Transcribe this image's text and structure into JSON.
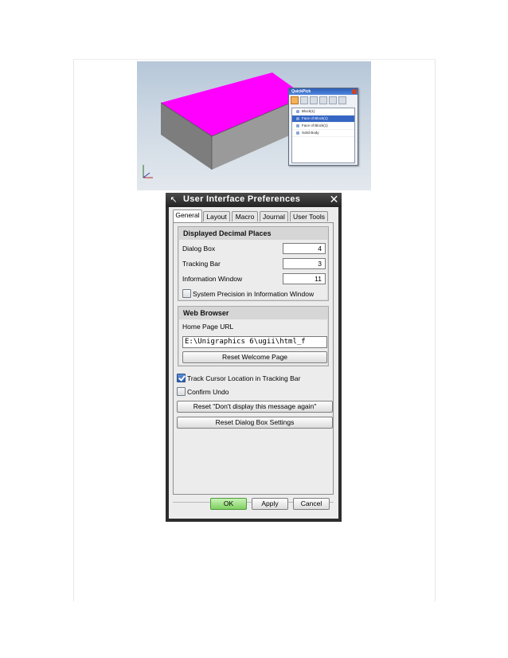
{
  "viewport": {
    "quickpick": {
      "title": "QuickPick",
      "items": [
        "Block(1)",
        "Face of Block(1)",
        "Face of Block(1)",
        "Solid Body"
      ],
      "selected_index": 1
    },
    "colors": {
      "top_face": "#ff00ff",
      "side_face": "#8c8c8c"
    }
  },
  "dialog": {
    "title": "User Interface Preferences",
    "tabs": [
      {
        "label": "General"
      },
      {
        "label": "Layout"
      },
      {
        "label": "Macro"
      },
      {
        "label": "Journal"
      },
      {
        "label": "User Tools"
      }
    ],
    "active_tab": "General",
    "decimal_group": {
      "title": "Displayed Decimal Places",
      "dialog_box": {
        "label": "Dialog Box",
        "value": "4"
      },
      "tracking_bar": {
        "label": "Tracking Bar",
        "value": "3"
      },
      "information_window": {
        "label": "Information Window",
        "value": "11"
      },
      "system_precision": {
        "label": "System Precision in Information Window",
        "checked": false
      }
    },
    "web_group": {
      "title": "Web Browser",
      "home_page_label": "Home Page URL",
      "home_page_value": "E:\\Unigraphics 6\\ugii\\html_f",
      "reset_welcome": "Reset Welcome Page"
    },
    "track_cursor": {
      "label": "Track Cursor Location in Tracking Bar",
      "checked": true
    },
    "confirm_undo": {
      "label": "Confirm Undo",
      "checked": false
    },
    "reset_dont_display": "Reset \"Don't display this message again\"",
    "reset_dialog_settings": "Reset Dialog Box Settings",
    "buttons": {
      "ok": "OK",
      "apply": "Apply",
      "cancel": "Cancel"
    }
  }
}
